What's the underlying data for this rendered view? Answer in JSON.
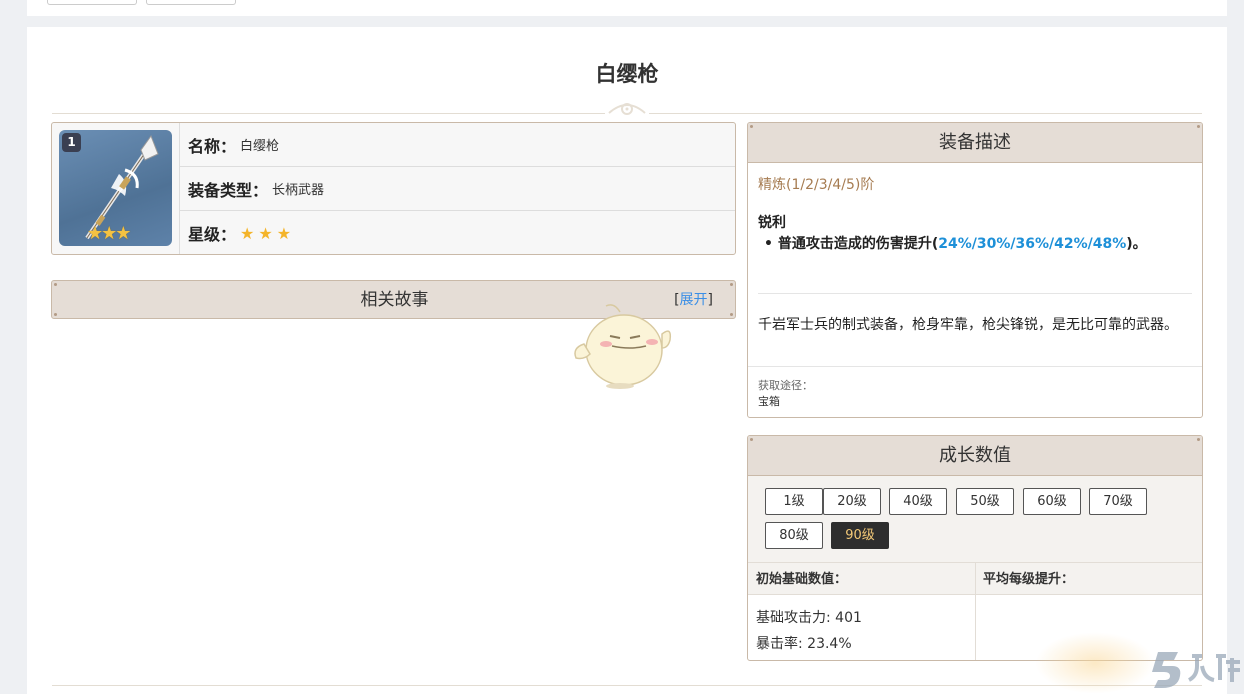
{
  "page": {
    "title": "白缨枪"
  },
  "info": {
    "refine_badge": "1",
    "name_label": "名称：",
    "name_value": "白缨枪",
    "type_label": "装备类型：",
    "type_value": "长柄武器",
    "rarity_label": "星级：",
    "rarity_stars": 3,
    "star_glyph": "★",
    "image_stars": "★★★"
  },
  "story": {
    "title": "相关故事",
    "bracket_open": "[",
    "expand_link": "展开",
    "bracket_close": "]"
  },
  "description": {
    "header": "装备描述",
    "refine": "精炼(1/2/3/4/5)阶",
    "passive_name": "锐利",
    "passive_bullet": "•",
    "passive_text": "普通攻击造成的伤害提升(",
    "passive_values": "24%/30%/36%/42%/48%",
    "passive_end": ")。",
    "lore": "千岩军士兵的制式装备，枪身牢靠，枪尖锋锐，是无比可靠的武器。",
    "source_label": "获取途径：",
    "source_value": "宝箱"
  },
  "growth": {
    "header": "成长数值",
    "levels": [
      "1级",
      "20级",
      "40级",
      "50级",
      "60级",
      "70级",
      "80级",
      "90级"
    ],
    "active_level": "90级",
    "base_header": "初始基础数值：",
    "per_level_header": "平均每级提升：",
    "base_atk": "基础攻击力: 401",
    "crit_rate": "暴击率: 23.4%"
  },
  "colors": {
    "accent_blue": "#1e90d8",
    "link_blue": "#3a8ee6",
    "refine_brown": "#a67c52",
    "header_bg": "#e5ddd6",
    "border": "#c9b9a8",
    "active_level_bg": "#2e2e2e",
    "active_level_text": "#f2c877",
    "star_gold": "#f4b42a"
  },
  "icons": {
    "weapon": "white-tassel-spear-icon",
    "mascot": "paimon-sticker-icon",
    "watermark": "jiuyou-logo-icon",
    "ornament": "title-ornament-icon"
  }
}
